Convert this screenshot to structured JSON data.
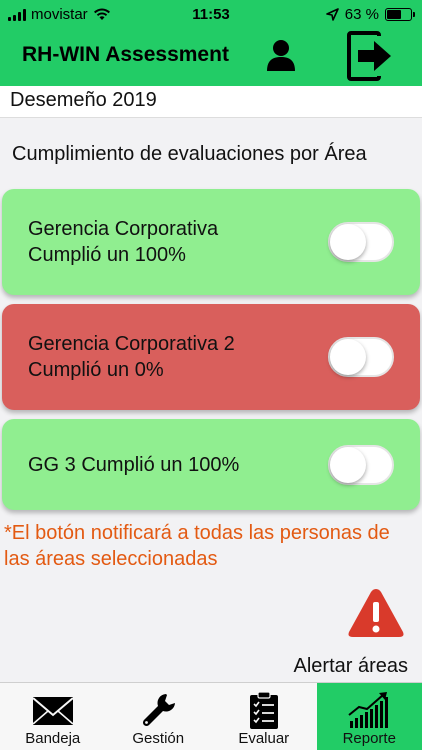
{
  "status_bar": {
    "carrier": "movistar",
    "time": "11:53",
    "battery": "63 %",
    "battery_level": 0.63
  },
  "header": {
    "title": "RH-WIN Assessment",
    "user_icon": "user-icon",
    "logout_icon": "logout-icon"
  },
  "period_field": {
    "value": "Desemeño 2019"
  },
  "section": {
    "title": "Cumplimiento de evaluaciones por Área"
  },
  "areas": [
    {
      "line1": "Gerencia Corporativa",
      "line2": "Cumplió un 100%",
      "color": "#90ee90",
      "toggle_on": false
    },
    {
      "line1": "Gerencia Corporativa 2",
      "line2": "Cumplió un 0%",
      "color": "#d95f5c",
      "toggle_on": false
    },
    {
      "line1": "GG 3 Cumplió un 100%",
      "line2": "",
      "color": "#90ee90",
      "toggle_on": false
    }
  ],
  "note": "*El botón notificará a todas las personas de las áreas seleccionadas",
  "alert": {
    "label": "Alertar áreas",
    "icon": "warning-icon",
    "color": "#d93a2b"
  },
  "tabs": [
    {
      "label": "Bandeja",
      "icon": "envelope-icon",
      "active": false
    },
    {
      "label": "Gestión",
      "icon": "wrench-icon",
      "active": false
    },
    {
      "label": "Evaluar",
      "icon": "clipboard-icon",
      "active": false
    },
    {
      "label": "Reporte",
      "icon": "chart-icon",
      "active": true
    }
  ],
  "colors": {
    "brand": "#22cc66",
    "success": "#90ee90",
    "danger": "#d95f5c",
    "note": "#e35a12"
  }
}
